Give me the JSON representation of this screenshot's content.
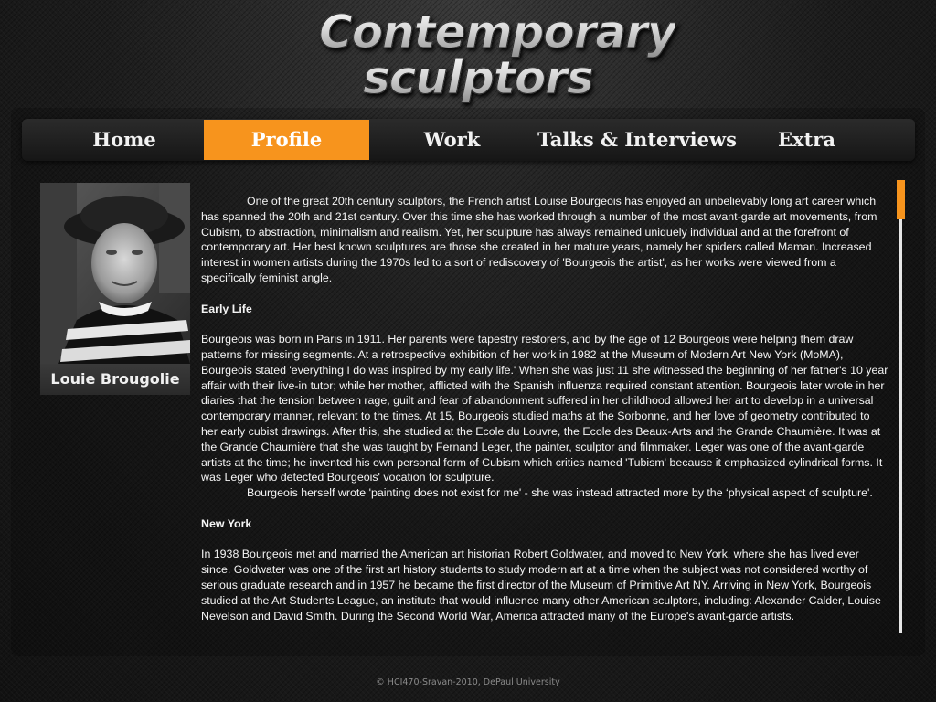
{
  "logo": {
    "line1": "Contemporary",
    "line2": "sculptors"
  },
  "nav": {
    "items": [
      "Home",
      "Profile",
      "Work",
      "Talks & Interviews",
      "Extra"
    ],
    "active": "Profile",
    "accent": "#f7941d"
  },
  "profile": {
    "caption": "Louie Brougolie"
  },
  "article": {
    "intro": "One of the great 20th century sculptors, the French artist Louise Bourgeois has enjoyed an unbelievably long art career which has spanned the 20th and 21st century. Over this time she has worked through a number of the most avant-garde art movements, from Cubism, to abstraction, minimalism and realism. Yet, her sculpture has always remained uniquely individual and at the forefront of contemporary art. Her best known sculptures are those she created in her mature years, namely her spiders called Maman. Increased interest in women artists during the 1970s led to a sort of rediscovery of 'Bourgeois the artist', as her works were viewed from a specifically feminist angle.",
    "early_life_heading": "Early Life",
    "early_life_p1": "Bourgeois was born in Paris in 1911. Her parents were tapestry restorers, and by the age of 12 Bourgeois were helping them draw patterns for missing segments. At a retrospective exhibition of her work in 1982 at the Museum of Modern Art New York (MoMA), Bourgeois stated 'everything I do was inspired by my early life.' When she was just 11 she witnessed the beginning of her father's 10 year affair with their live-in tutor; while her mother, afflicted with the Spanish influenza required constant attention. Bourgeois later wrote in her diaries that the tension between rage, guilt and fear of abandonment suffered in her childhood allowed her art to develop in a universal contemporary manner, relevant to the times. At 15, Bourgeois studied maths at the Sorbonne, and her love of geometry contributed to her early cubist drawings. After this, she studied at the Ecole du Louvre, the Ecole des Beaux-Arts and the Grande Chaumière. It was at the Grande Chaumière that she was taught by Fernand Leger, the painter, sculptor and filmmaker. Leger was one of the avant-garde artists at the time; he invented his own personal form of Cubism which critics named 'Tubism' because it emphasized cylindrical forms. It was Leger who detected Bourgeois' vocation for sculpture.",
    "early_life_p2": "Bourgeois herself wrote 'painting does not exist for me' - she was instead attracted more by the ‘physical aspect of sculpture'.",
    "new_york_heading": "New York",
    "new_york_p1": "In 1938 Bourgeois met and married the American art historian Robert Goldwater, and moved to New York, where she has lived ever since. Goldwater was one of the first art history students to study modern art at a time when the subject was not considered worthy of serious graduate research and in 1957 he became the first director of the Museum of Primitive Art NY. Arriving in New York, Bourgeois studied at the Art Students League, an institute that would influence many other American sculptors, including: Alexander Calder, Louise Nevelson and David Smith. During the Second World War, America attracted many of the Europe's avant-garde artists."
  },
  "footer": {
    "text": "© HCI470-Sravan-2010, DePaul University"
  }
}
